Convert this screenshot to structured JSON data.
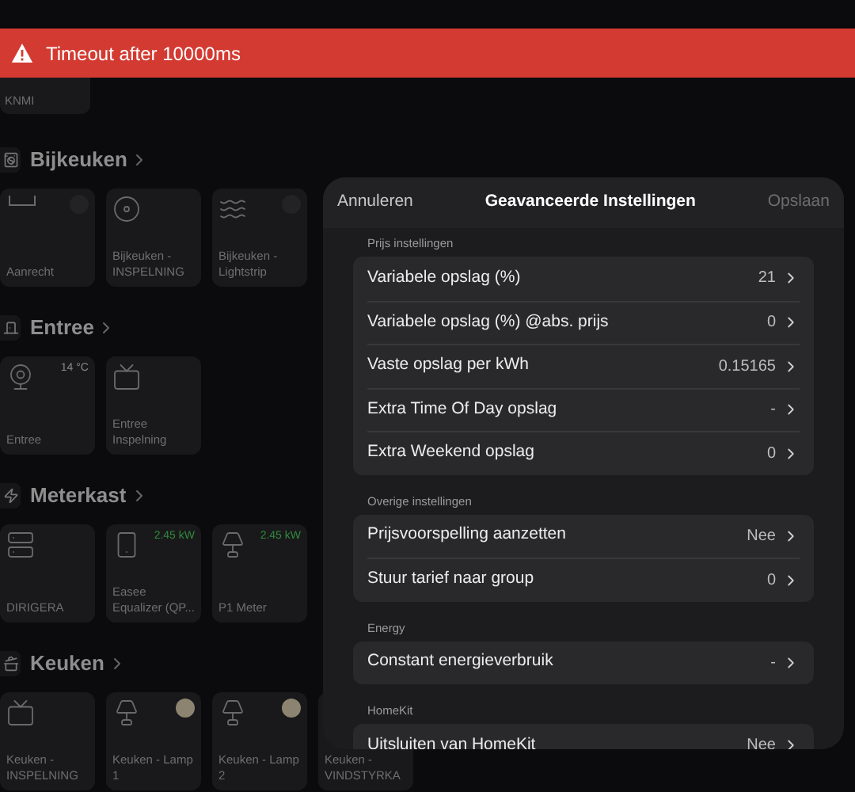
{
  "banner": {
    "message": "Timeout after 10000ms"
  },
  "top_tile": {
    "name": "KNMI"
  },
  "sections": [
    {
      "title": "Bijkeuken",
      "tiles": [
        {
          "name": "Aanrecht",
          "kind": "switch",
          "on": false
        },
        {
          "name": "Bijkeuken - INSPELNING",
          "kind": "device"
        },
        {
          "name": "Bijkeuken - Lightstrip",
          "kind": "switch",
          "on": false
        }
      ]
    },
    {
      "title": "Entree",
      "tiles": [
        {
          "name": "Entree",
          "kind": "sensor",
          "reading": "14 °C",
          "color": "#8a8a8a"
        },
        {
          "name": "Entree Inspelning",
          "kind": "device"
        }
      ]
    },
    {
      "title": "Meterkast",
      "tiles": [
        {
          "name": "DIRIGERA",
          "kind": "device"
        },
        {
          "name": "Easee Equalizer (QP...",
          "kind": "sensor",
          "reading": "2.45 kW",
          "color": "#2f8a3c"
        },
        {
          "name": "P1 Meter",
          "kind": "sensor",
          "reading": "2.45 kW",
          "color": "#2f8a3c"
        }
      ]
    },
    {
      "title": "Keuken",
      "tiles": [
        {
          "name": "Keuken - INSPELNING",
          "kind": "device"
        },
        {
          "name": "Keuken - Lamp 1",
          "kind": "switch",
          "on": true
        },
        {
          "name": "Keuken - Lamp 2",
          "kind": "switch",
          "on": true
        },
        {
          "name": "Keuken - VINDSTYRKA",
          "kind": "device"
        }
      ]
    }
  ],
  "dialog": {
    "cancel": "Annuleren",
    "title": "Geavanceerde Instellingen",
    "save": "Opslaan",
    "save_disabled": true,
    "groups": [
      {
        "label": "Prijs instellingen",
        "rows": [
          {
            "label": "Variabele opslag (%)",
            "value": "21"
          },
          {
            "label": "Variabele opslag (%) @abs. prijs",
            "value": "0"
          },
          {
            "label": "Vaste opslag per kWh",
            "value": "0.15165"
          },
          {
            "label": "Extra Time Of Day opslag",
            "value": "-"
          },
          {
            "label": "Extra Weekend opslag",
            "value": "0"
          }
        ]
      },
      {
        "label": "Overige instellingen",
        "rows": [
          {
            "label": "Prijsvoorspelling aanzetten",
            "value": "Nee"
          },
          {
            "label": "Stuur tarief naar group",
            "value": "0"
          }
        ]
      },
      {
        "label": "Energy",
        "rows": [
          {
            "label": "Constant energieverbruik",
            "value": "-"
          }
        ]
      },
      {
        "label": "HomeKit",
        "rows": [
          {
            "label": "Uitsluiten van HomeKit",
            "value": "Nee"
          }
        ]
      }
    ]
  }
}
